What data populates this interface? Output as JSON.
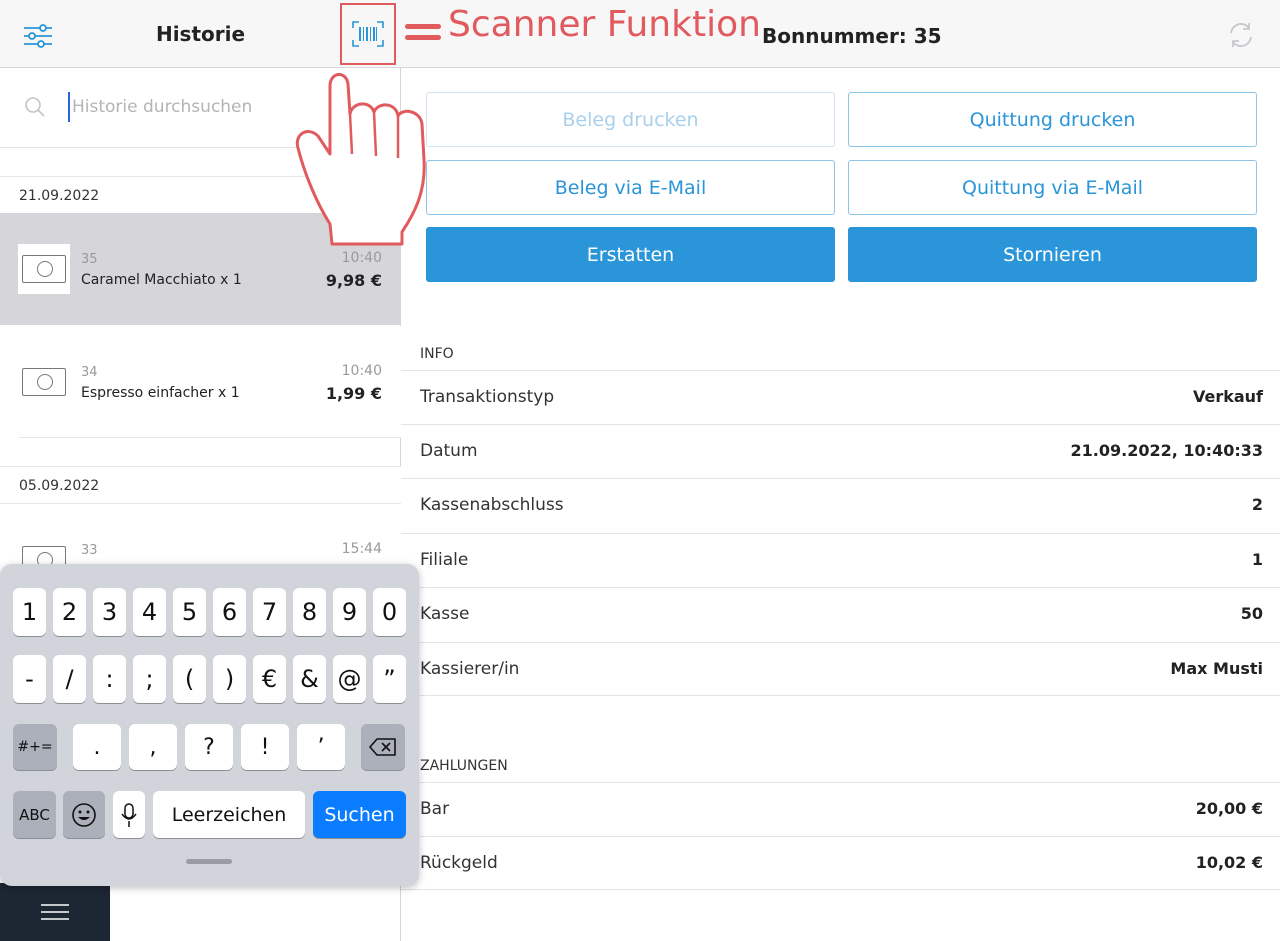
{
  "left": {
    "title": "Historie",
    "search_placeholder": "Historie durchsuchen",
    "groups": [
      {
        "date": "21.09.2022",
        "items": [
          {
            "number": "35",
            "name": "Caramel Macchiato x 1",
            "time": "10:40",
            "price": "9,98 €",
            "selected": true
          },
          {
            "number": "34",
            "name": "Espresso einfacher x 1",
            "time": "10:40",
            "price": "1,99 €",
            "selected": false
          }
        ]
      },
      {
        "date": "05.09.2022",
        "items": [
          {
            "number": "33",
            "name": "",
            "time": "15:44",
            "price": "",
            "selected": false
          }
        ]
      }
    ]
  },
  "annotation": {
    "text": "Scanner Funktion",
    "color": "#e05a5e"
  },
  "right": {
    "bon_title": "Bonnummer: 35",
    "buttons": {
      "beleg_drucken": "Beleg drucken",
      "quittung_drucken": "Quittung drucken",
      "beleg_email": "Beleg via E-Mail",
      "quittung_email": "Quittung via E-Mail",
      "erstatten": "Erstatten",
      "stornieren": "Stornieren"
    },
    "info_label": "INFO",
    "info_rows": [
      {
        "label": "Transaktionstyp",
        "value": "Verkauf"
      },
      {
        "label": "Datum",
        "value": "21.09.2022, 10:40:33"
      },
      {
        "label": "Kassenabschluss",
        "value": "2"
      },
      {
        "label": "Filiale",
        "value": "1"
      },
      {
        "label": "Kasse",
        "value": "50"
      },
      {
        "label": "Kassierer/in",
        "value": "Max Musti"
      }
    ],
    "payments_label": "ZAHLUNGEN",
    "payment_rows": [
      {
        "label": "Bar",
        "value": "20,00 €"
      },
      {
        "label": "Rückgeld",
        "value": "10,02 €"
      }
    ]
  },
  "keyboard": {
    "row1": [
      "1",
      "2",
      "3",
      "4",
      "5",
      "6",
      "7",
      "8",
      "9",
      "0"
    ],
    "row2": [
      "-",
      "/",
      ":",
      ";",
      "(",
      ")",
      "€",
      "&",
      "@",
      "”"
    ],
    "row3_left": "#+=",
    "row3": [
      ".",
      ",",
      "?",
      "!",
      "’"
    ],
    "abc": "ABC",
    "space": "Leerzeichen",
    "search": "Suchen"
  },
  "colors": {
    "accent": "#2a95d8",
    "selected_row": "#d5d5da",
    "keyboard_blue": "#0a7cff",
    "nav_dark": "#1d2633"
  }
}
